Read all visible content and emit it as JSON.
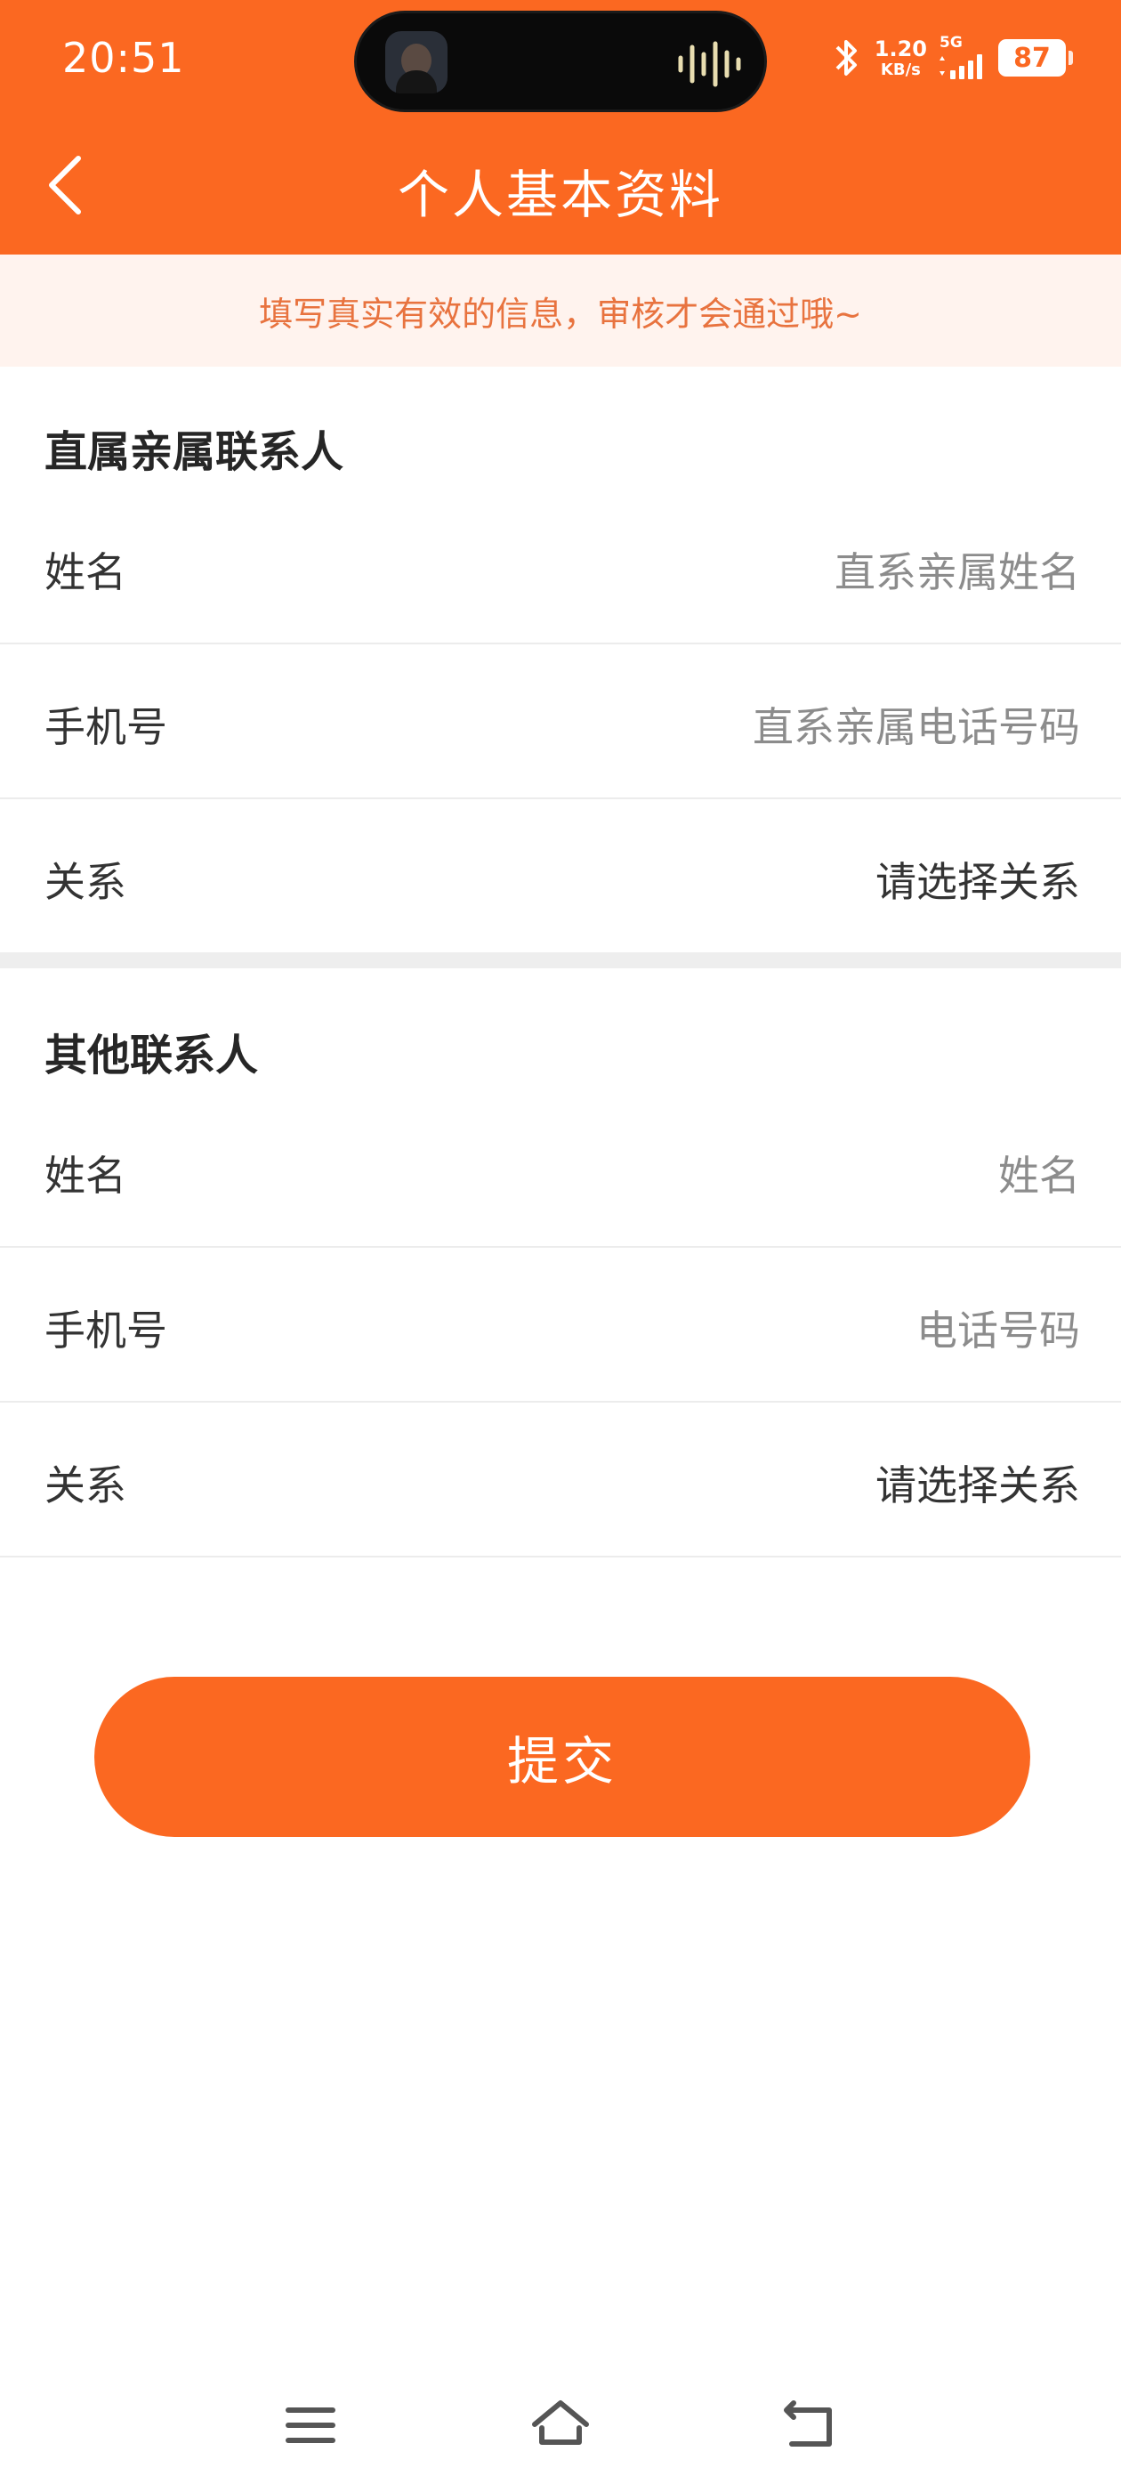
{
  "status_bar": {
    "time": "20:51",
    "net_speed_value": "1.20",
    "net_speed_unit": "KB/s",
    "network_type": "5G",
    "battery": "87"
  },
  "nav": {
    "title": "个人基本资料",
    "back_icon": "chevron-left-icon"
  },
  "notice": "填写真实有效的信息，审核才会通过哦~",
  "sections": [
    {
      "title": "直属亲属联系人",
      "fields": [
        {
          "label": "姓名",
          "placeholder": "直系亲属姓名"
        },
        {
          "label": "手机号",
          "placeholder": "直系亲属电话号码"
        },
        {
          "label": "关系",
          "value": "请选择关系"
        }
      ]
    },
    {
      "title": "其他联系人",
      "fields": [
        {
          "label": "姓名",
          "placeholder": "姓名"
        },
        {
          "label": "手机号",
          "placeholder": "电话号码"
        },
        {
          "label": "关系",
          "value": "请选择关系"
        }
      ]
    }
  ],
  "submit_label": "提交",
  "system_nav": [
    "menu-icon",
    "home-icon",
    "back-icon"
  ],
  "colors": {
    "brand": "#FB6821",
    "notice_bg": "#FFF3EE",
    "notice_text": "#E8733F"
  }
}
